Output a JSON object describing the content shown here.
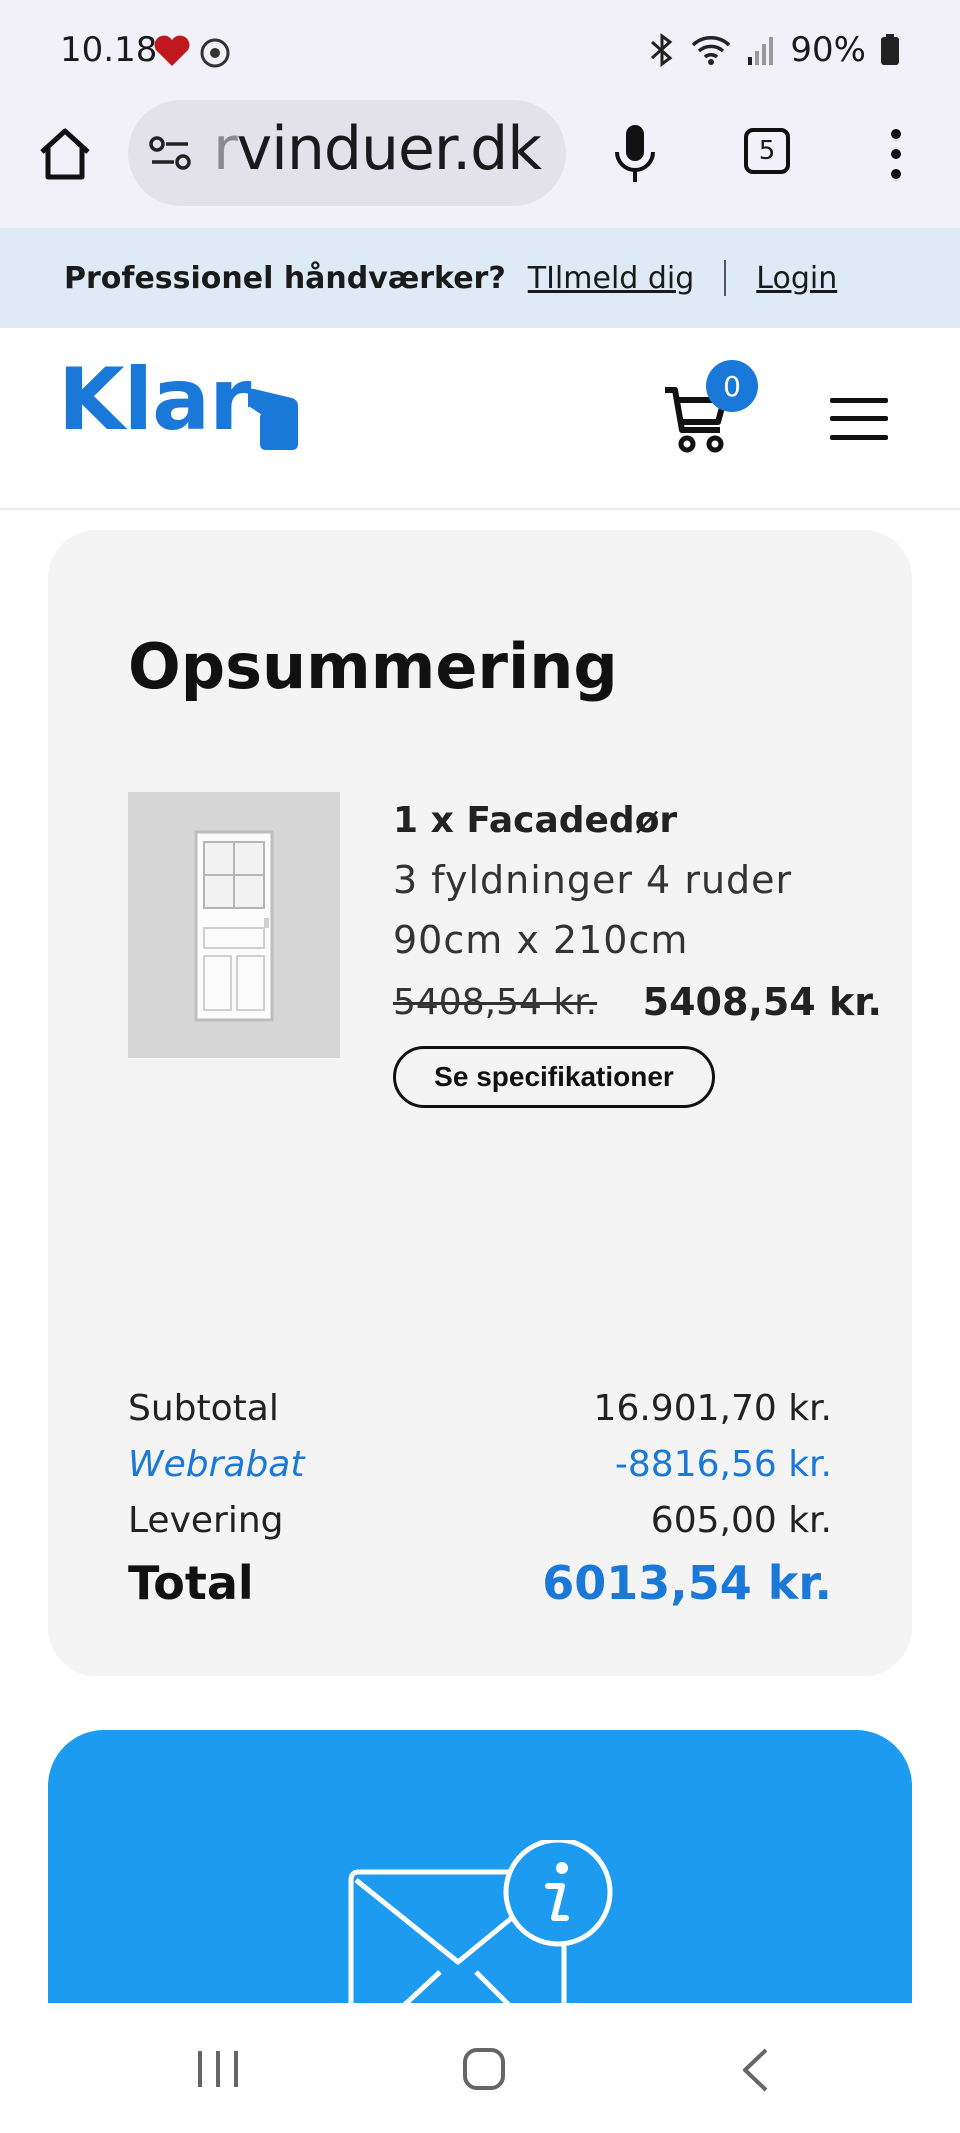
{
  "status_bar": {
    "time": "10.18",
    "battery": "90%",
    "icons": [
      "heart-notification-icon",
      "gear-badge-icon",
      "bluetooth-icon",
      "wifi-icon",
      "signal-icon",
      "battery-icon"
    ]
  },
  "browser": {
    "url": "rvinduer.dk",
    "url_faded_prefix": "r",
    "url_rest": "vinduer.dk",
    "tab_count": "5"
  },
  "pro_bar": {
    "question": "Professionel håndværker?",
    "signup": "TIlmeld dig",
    "login": "Login"
  },
  "header": {
    "logo": "Klar",
    "cart_count": "0"
  },
  "summary": {
    "title": "Opsummering",
    "item": {
      "title": "1 x Facadedør",
      "variant": "3 fyldninger 4 ruder",
      "size": "90cm x 210cm",
      "old_price": "5408,54 kr.",
      "price": "5408,54 kr.",
      "spec_button": "Se specifikationer"
    },
    "rows": {
      "subtotal_label": "Subtotal",
      "subtotal_value": "16.901,70 kr.",
      "discount_label": "Webrabat",
      "discount_value": "-8816,56 kr.",
      "delivery_label": "Levering",
      "delivery_value": "605,00 kr.",
      "total_label": "Total",
      "total_value": "6013,54 kr."
    }
  },
  "colors": {
    "brand": "#1a78d8",
    "info_card": "#1d9bf0",
    "card_bg": "#f4f4f4",
    "pro_bar_bg": "#deeaf6"
  }
}
